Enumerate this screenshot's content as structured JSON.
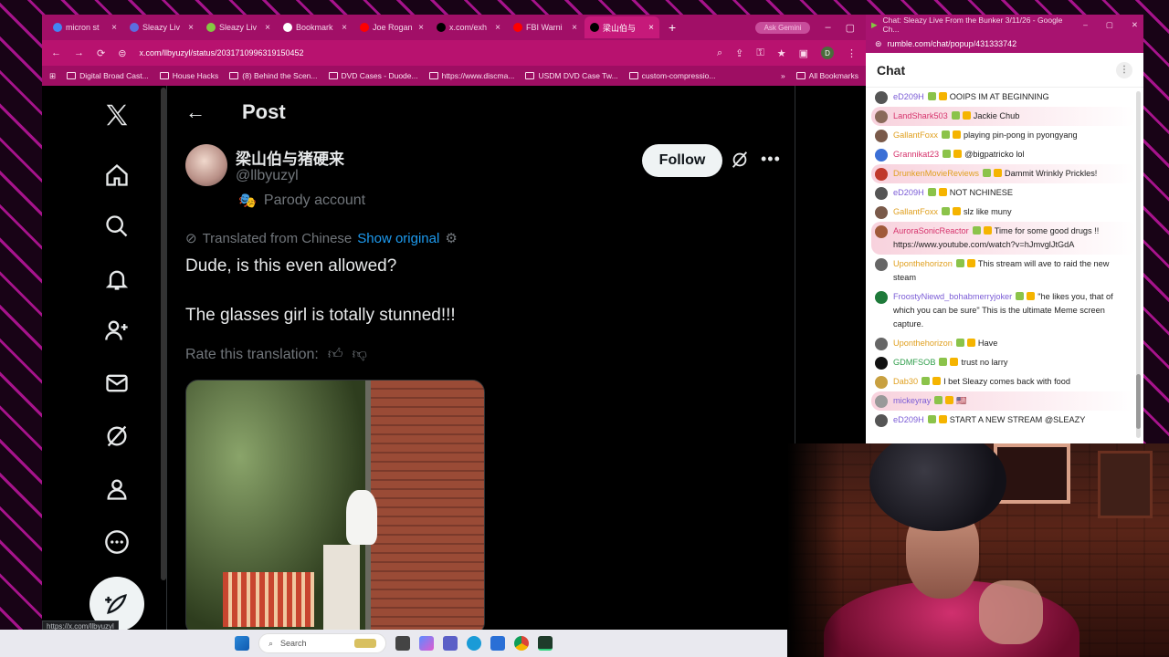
{
  "browser": {
    "tabs": [
      {
        "label": "micron st",
        "color": "#4285f4"
      },
      {
        "label": "Sleazy Liv",
        "color": "#5b6ee1"
      },
      {
        "label": "Sleazy Liv",
        "color": "#85c742"
      },
      {
        "label": "Bookmark",
        "color": "#ffffff"
      },
      {
        "label": "Joe Rogan",
        "color": "#ff0000"
      },
      {
        "label": "x.com/exh",
        "color": "#000000"
      },
      {
        "label": "FBI Warni",
        "color": "#ff0000"
      },
      {
        "label": "梁山伯与",
        "color": "#000000"
      }
    ],
    "new_tab": "+",
    "tab_pill": "Ask Gemini",
    "url": "x.com/llbyuzyl/status/2031710996319150452",
    "profile_initial": "D",
    "bookmarks": [
      "Digital Broad Cast...",
      "House Hacks",
      "(8) Behind the Scen...",
      "DVD Cases - Duode...",
      "https://www.discma...",
      "USDM DVD Case Tw...",
      "custom-compressio..."
    ],
    "all_bookmarks": "All Bookmarks",
    "status_url": "https://x.com/llbyuzyl"
  },
  "post": {
    "header_title": "Post",
    "display_name": "梁山伯与猪硬来",
    "handle": "@llbyuzyl",
    "parody_label": "Parody account",
    "follow_label": "Follow",
    "translated_from": "Translated from Chinese",
    "show_original": "Show original",
    "text_line1": "Dude, is this even allowed?",
    "text_line2": "The glasses girl is totally stunned!!!",
    "rate_label": "Rate this translation:"
  },
  "chat": {
    "window_title": "Chat: Sleazy Live From the Bunker 3/11/26 - Google Ch...",
    "url": "rumble.com/chat/popup/431333742",
    "heading": "Chat",
    "messages": [
      {
        "user": "eD209H",
        "text": "OOIPS IM AT BEGINNING",
        "color": "#7b5cd6",
        "av": "#555",
        "hl": false
      },
      {
        "user": "LandShark503",
        "text": "Jackie Chub",
        "color": "#d6336c",
        "av": "#8a6a5a",
        "hl": true
      },
      {
        "user": "GallantFoxx",
        "text": "playing pin-pong in pyongyang",
        "color": "#e0a020",
        "av": "#7a5a4a",
        "hl": false
      },
      {
        "user": "Grannikat23",
        "text": "@bigpatricko lol",
        "color": "#d6336c",
        "av": "#3b6fd6",
        "hl": false
      },
      {
        "user": "DrunkenMovieReviews",
        "text": "Dammit Wrinkly Prickles!",
        "color": "#e0a020",
        "av": "#c0392b",
        "hl": true
      },
      {
        "user": "eD209H",
        "text": "NOT NCHINESE",
        "color": "#7b5cd6",
        "av": "#555",
        "hl": false
      },
      {
        "user": "GallantFoxx",
        "text": "slz like muny",
        "color": "#e0a020",
        "av": "#7a5a4a",
        "hl": false
      },
      {
        "user": "AuroraSonicReactor",
        "text": "Time for some good drugs !! https://www.youtube.com/watch?v=hJmvglJtGdA",
        "color": "#d6336c",
        "av": "#a05a3a",
        "hl": true
      },
      {
        "user": "Uponthehorizon",
        "text": "This stream will ave to raid the new steam",
        "color": "#e0a020",
        "av": "#666",
        "hl": false
      },
      {
        "user": "FroostyNiewd_bohabmerryjoker",
        "text": "\"he likes you, that of which you can be sure\" This is the ultimate Meme screen capture.",
        "color": "#7b5cd6",
        "av": "#1e7a3a",
        "hl": false
      },
      {
        "user": "Uponthehorizon",
        "text": "Have",
        "color": "#e0a020",
        "av": "#666",
        "hl": false
      },
      {
        "user": "GDMFSOB",
        "text": "trust no larry",
        "color": "#2e9e4a",
        "av": "#111",
        "hl": false
      },
      {
        "user": "Dab30",
        "text": "I bet Sleazy comes back with food",
        "color": "#e0a020",
        "av": "#c8a040",
        "hl": false
      },
      {
        "user": "mickeyray",
        "text": "🇺🇸",
        "color": "#7b5cd6",
        "av": "#999",
        "hl": true
      },
      {
        "user": "eD209H",
        "text": "START A NEW STREAM @SLEAZY",
        "color": "#7b5cd6",
        "av": "#555",
        "hl": false
      }
    ]
  },
  "taskbar": {
    "search_placeholder": "Search"
  }
}
